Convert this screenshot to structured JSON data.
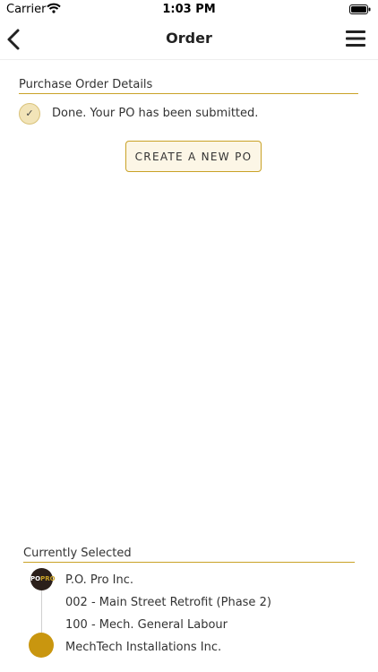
{
  "status_bar": {
    "carrier": "Carrier",
    "time": "1:03 PM"
  },
  "nav": {
    "title": "Order"
  },
  "details": {
    "section_title": "Purchase Order Details",
    "done_message": "Done. Your PO has been submitted.",
    "create_button_label": "CREATE A NEW PO"
  },
  "selected": {
    "section_title": "Currently Selected",
    "logo_text_a": "PO",
    "logo_text_b": "PRO",
    "items": [
      "P.O. Pro Inc.",
      "002 - Main Street Retrofit (Phase 2)",
      "100 - Mech. General Labour",
      "MechTech Installations Inc."
    ]
  },
  "colors": {
    "accent": "#c9a227",
    "accent_dark": "#c9960f"
  }
}
